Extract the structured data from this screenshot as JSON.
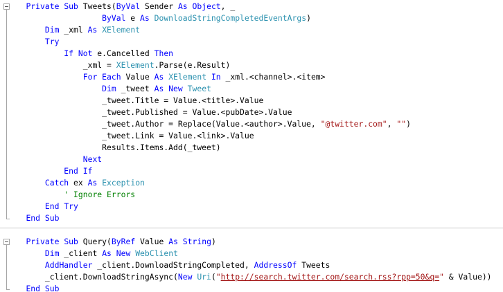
{
  "colors": {
    "keyword": "#0000ff",
    "type": "#2b91af",
    "string": "#a31515",
    "comment": "#008000",
    "plain": "#000000"
  },
  "lines": [
    [
      {
        "t": "    "
      },
      {
        "t": "Private",
        "k": "keyword"
      },
      {
        "t": " "
      },
      {
        "t": "Sub",
        "k": "keyword"
      },
      {
        "t": " Tweets("
      },
      {
        "t": "ByVal",
        "k": "keyword"
      },
      {
        "t": " Sender "
      },
      {
        "t": "As",
        "k": "keyword"
      },
      {
        "t": " "
      },
      {
        "t": "Object",
        "k": "keyword"
      },
      {
        "t": ", _"
      }
    ],
    [
      {
        "t": "                    "
      },
      {
        "t": "ByVal",
        "k": "keyword"
      },
      {
        "t": " e "
      },
      {
        "t": "As",
        "k": "keyword"
      },
      {
        "t": " "
      },
      {
        "t": "DownloadStringCompletedEventArgs",
        "k": "type"
      },
      {
        "t": ")"
      }
    ],
    [
      {
        "t": "        "
      },
      {
        "t": "Dim",
        "k": "keyword"
      },
      {
        "t": " _xml "
      },
      {
        "t": "As",
        "k": "keyword"
      },
      {
        "t": " "
      },
      {
        "t": "XElement",
        "k": "type"
      }
    ],
    [
      {
        "t": "        "
      },
      {
        "t": "Try",
        "k": "keyword"
      }
    ],
    [
      {
        "t": "            "
      },
      {
        "t": "If",
        "k": "keyword"
      },
      {
        "t": " "
      },
      {
        "t": "Not",
        "k": "keyword"
      },
      {
        "t": " e.Cancelled "
      },
      {
        "t": "Then",
        "k": "keyword"
      }
    ],
    [
      {
        "t": "                _xml = "
      },
      {
        "t": "XElement",
        "k": "type"
      },
      {
        "t": ".Parse(e.Result)"
      }
    ],
    [
      {
        "t": "                "
      },
      {
        "t": "For",
        "k": "keyword"
      },
      {
        "t": " "
      },
      {
        "t": "Each",
        "k": "keyword"
      },
      {
        "t": " Value "
      },
      {
        "t": "As",
        "k": "keyword"
      },
      {
        "t": " "
      },
      {
        "t": "XElement",
        "k": "type"
      },
      {
        "t": " "
      },
      {
        "t": "In",
        "k": "keyword"
      },
      {
        "t": " _xml.<channel>.<item>"
      }
    ],
    [
      {
        "t": "                    "
      },
      {
        "t": "Dim",
        "k": "keyword"
      },
      {
        "t": " _tweet "
      },
      {
        "t": "As",
        "k": "keyword"
      },
      {
        "t": " "
      },
      {
        "t": "New",
        "k": "keyword"
      },
      {
        "t": " "
      },
      {
        "t": "Tweet",
        "k": "type"
      }
    ],
    [
      {
        "t": "                    _tweet.Title = Value.<title>.Value"
      }
    ],
    [
      {
        "t": "                    _tweet.Published = Value.<pubDate>.Value"
      }
    ],
    [
      {
        "t": "                    _tweet.Author = Replace(Value.<author>.Value, "
      },
      {
        "t": "\"@twitter.com\"",
        "k": "string"
      },
      {
        "t": ", "
      },
      {
        "t": "\"\"",
        "k": "string"
      },
      {
        "t": ")"
      }
    ],
    [
      {
        "t": "                    _tweet.Link = Value.<link>.Value"
      }
    ],
    [
      {
        "t": "                    Results.Items.Add(_tweet)"
      }
    ],
    [
      {
        "t": "                "
      },
      {
        "t": "Next",
        "k": "keyword"
      }
    ],
    [
      {
        "t": "            "
      },
      {
        "t": "End",
        "k": "keyword"
      },
      {
        "t": " "
      },
      {
        "t": "If",
        "k": "keyword"
      }
    ],
    [
      {
        "t": "        "
      },
      {
        "t": "Catch",
        "k": "keyword"
      },
      {
        "t": " ex "
      },
      {
        "t": "As",
        "k": "keyword"
      },
      {
        "t": " "
      },
      {
        "t": "Exception",
        "k": "type"
      }
    ],
    [
      {
        "t": "            "
      },
      {
        "t": "' Ignore Errors",
        "k": "comment"
      }
    ],
    [
      {
        "t": "        "
      },
      {
        "t": "End",
        "k": "keyword"
      },
      {
        "t": " "
      },
      {
        "t": "Try",
        "k": "keyword"
      }
    ],
    [
      {
        "t": "    "
      },
      {
        "t": "End",
        "k": "keyword"
      },
      {
        "t": " "
      },
      {
        "t": "Sub",
        "k": "keyword"
      }
    ],
    [
      {
        "t": ""
      }
    ],
    [
      {
        "t": "    "
      },
      {
        "t": "Private",
        "k": "keyword"
      },
      {
        "t": " "
      },
      {
        "t": "Sub",
        "k": "keyword"
      },
      {
        "t": " Query("
      },
      {
        "t": "ByRef",
        "k": "keyword"
      },
      {
        "t": " Value "
      },
      {
        "t": "As",
        "k": "keyword"
      },
      {
        "t": " "
      },
      {
        "t": "String",
        "k": "keyword"
      },
      {
        "t": ")"
      }
    ],
    [
      {
        "t": "        "
      },
      {
        "t": "Dim",
        "k": "keyword"
      },
      {
        "t": " _client "
      },
      {
        "t": "As",
        "k": "keyword"
      },
      {
        "t": " "
      },
      {
        "t": "New",
        "k": "keyword"
      },
      {
        "t": " "
      },
      {
        "t": "WebClient",
        "k": "type"
      }
    ],
    [
      {
        "t": "        "
      },
      {
        "t": "AddHandler",
        "k": "keyword"
      },
      {
        "t": " _client.DownloadStringCompleted, "
      },
      {
        "t": "AddressOf",
        "k": "keyword"
      },
      {
        "t": " Tweets"
      }
    ],
    [
      {
        "t": "        _client.DownloadStringAsync("
      },
      {
        "t": "New",
        "k": "keyword"
      },
      {
        "t": " "
      },
      {
        "t": "Uri",
        "k": "type"
      },
      {
        "t": "("
      },
      {
        "t": "\"",
        "k": "string"
      },
      {
        "t": "http://search.twitter.com/search.rss?rpp=50&q=",
        "k": "string",
        "u": true
      },
      {
        "t": "\"",
        "k": "string"
      },
      {
        "t": " & Value))"
      }
    ],
    [
      {
        "t": "    "
      },
      {
        "t": "End",
        "k": "keyword"
      },
      {
        "t": " "
      },
      {
        "t": "Sub",
        "k": "keyword"
      }
    ]
  ]
}
